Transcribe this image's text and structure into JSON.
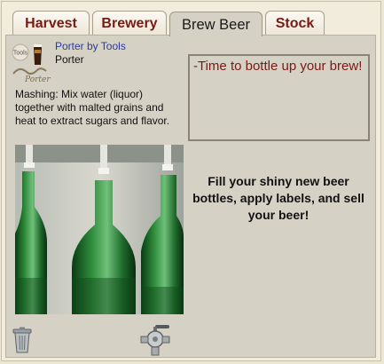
{
  "tabs": [
    {
      "label": "Harvest"
    },
    {
      "label": "Brewery"
    },
    {
      "label": "Brew Beer"
    },
    {
      "label": "Stock"
    }
  ],
  "active_tab": "Brew Beer",
  "beer": {
    "logo_text": "Tools",
    "logo_script": "Porter",
    "link_label": "Porter by Tools",
    "name": "Porter"
  },
  "step_description": "Mashing: Mix water (liquor) together with malted grains and heat to extract sugars and flavor.",
  "message": "-Time to bottle up your brew!",
  "call_to_action": "Fill your shiny new beer bottles, apply labels, and sell your beer!",
  "icons": {
    "trash": "trash-can-icon",
    "tap": "tap-valve-icon"
  }
}
